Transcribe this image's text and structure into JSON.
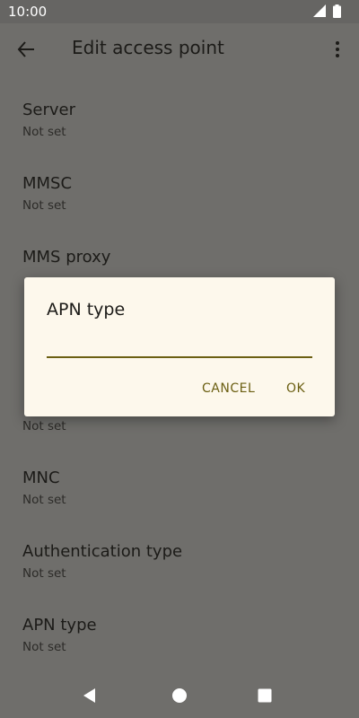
{
  "status_bar": {
    "time": "10:00",
    "icons": [
      "signal-icon",
      "battery-icon"
    ]
  },
  "app_bar": {
    "title": "Edit access point",
    "back_icon": "arrow-back-icon",
    "more_icon": "more-vert-icon"
  },
  "settings": [
    {
      "title": "Server",
      "summary": "Not set"
    },
    {
      "title": "MMSC",
      "summary": "Not set"
    },
    {
      "title": "MMS proxy",
      "summary": ""
    },
    {
      "title": "",
      "summary": ""
    },
    {
      "title": "",
      "summary": "Not set"
    },
    {
      "title": "MNC",
      "summary": "Not set"
    },
    {
      "title": "Authentication type",
      "summary": "Not set"
    },
    {
      "title": "APN type",
      "summary": "Not set"
    }
  ],
  "dialog": {
    "title": "APN type",
    "input_value": "",
    "cancel_label": "CANCEL",
    "ok_label": "OK"
  },
  "nav_bar": {
    "icons": [
      "back-triangle-icon",
      "home-circle-icon",
      "recents-square-icon"
    ]
  },
  "colors": {
    "scrim_background": "#6f6e6b",
    "dialog_background": "#fdf8ec",
    "accent": "#6b5f12"
  }
}
